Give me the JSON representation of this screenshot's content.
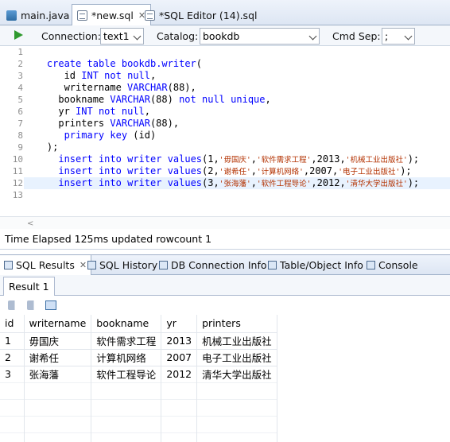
{
  "editor_tabs": [
    {
      "label": "main.java",
      "icon": "java-file-icon",
      "active": false
    },
    {
      "label": "*new.sql",
      "icon": "sql-file-icon",
      "active": true
    },
    {
      "label": "*SQL Editor (14).sql",
      "icon": "sql-file-icon",
      "active": false
    }
  ],
  "toolbar": {
    "connection_label": "Connection:",
    "connection_value": "text1",
    "catalog_label": "Catalog:",
    "catalog_value": "bookdb",
    "cmd_sep_label": "Cmd Sep:",
    "cmd_sep_value": ";"
  },
  "code": {
    "line_numbers": [
      "1",
      "2",
      "3",
      "4",
      "5",
      "6",
      "7",
      "8",
      "9",
      "10",
      "11",
      "12",
      "13"
    ],
    "highlighted_line": 12,
    "lines": [
      "",
      "    create table bookdb.writer(",
      "       id INT not null,",
      "       writername VARCHAR(88),",
      "      bookname VARCHAR(88) not null unique,",
      "      yr INT not null,",
      "      printers VARCHAR(88),",
      "       primary key (id)",
      "    );",
      "      insert into writer values(1,'毋国庆','软件需求工程',2013,'机械工业出版社');",
      "      insert into writer values(2,'谢希任','计算机网络',2007,'电子工业出版社');",
      "      insert into writer values(3,'张海藩','软件工程导论',2012,'清华大学出版社');",
      ""
    ]
  },
  "status": {
    "text": "Time Elapsed 125ms updated rowcount 1"
  },
  "view_tabs": [
    {
      "label": "SQL Results",
      "icon": "sql-results-icon",
      "active": true
    },
    {
      "label": "SQL History",
      "icon": "sql-history-icon",
      "active": false
    },
    {
      "label": "DB Connection Info",
      "icon": "db-connection-icon",
      "active": false
    },
    {
      "label": "Table/Object Info",
      "icon": "table-object-icon",
      "active": false
    },
    {
      "label": "Console",
      "icon": "console-icon",
      "active": false
    }
  ],
  "result_tab": {
    "label": "Result 1"
  },
  "results": {
    "columns": [
      "id",
      "writername",
      "bookname",
      "yr",
      "printers"
    ],
    "rows": [
      [
        "1",
        "毋国庆",
        "软件需求工程",
        "2013",
        "机械工业出版社"
      ],
      [
        "2",
        "谢希任",
        "计算机网络",
        "2007",
        "电子工业出版社"
      ],
      [
        "3",
        "张海藩",
        "软件工程导论",
        "2012",
        "清华大学出版社"
      ]
    ]
  }
}
